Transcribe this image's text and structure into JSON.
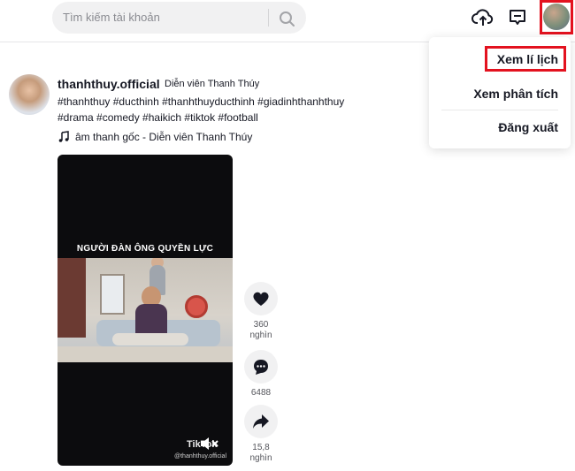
{
  "header": {
    "search_placeholder": "Tìm kiếm tài khoản",
    "icons": [
      "search-icon",
      "upload-icon",
      "inbox-icon",
      "avatar"
    ]
  },
  "menu": {
    "items": [
      {
        "label": "Xem lí lịch",
        "highlighted": true
      },
      {
        "label": "Xem phân tích",
        "highlighted": false
      },
      {
        "label": "Đăng xuất",
        "highlighted": false
      }
    ]
  },
  "post": {
    "username": "thanhthuy.official",
    "nickname": "Diễn viên Thanh Thúy",
    "desc_line1": "#thanhthuy #ducthinh #thanhthuyducthinh #giadinhthanhthuy",
    "desc_line2": "#drama #comedy #haikich #tiktok #football",
    "music": "âm thanh gốc - Diễn viên Thanh Thúy",
    "video": {
      "title": "NGƯỜI ĐÀN ÔNG QUYỀN LỰC",
      "logo": "TikTok",
      "watermark": "@thanhthuy.official"
    },
    "actions": {
      "likes_value": "360",
      "likes_unit": "nghìn",
      "comments": "6488",
      "shares_value": "15,8",
      "shares_unit": "nghìn"
    }
  },
  "colors": {
    "highlight": "#e3121f",
    "search_bg": "#f1f1f2",
    "text": "#161823"
  }
}
